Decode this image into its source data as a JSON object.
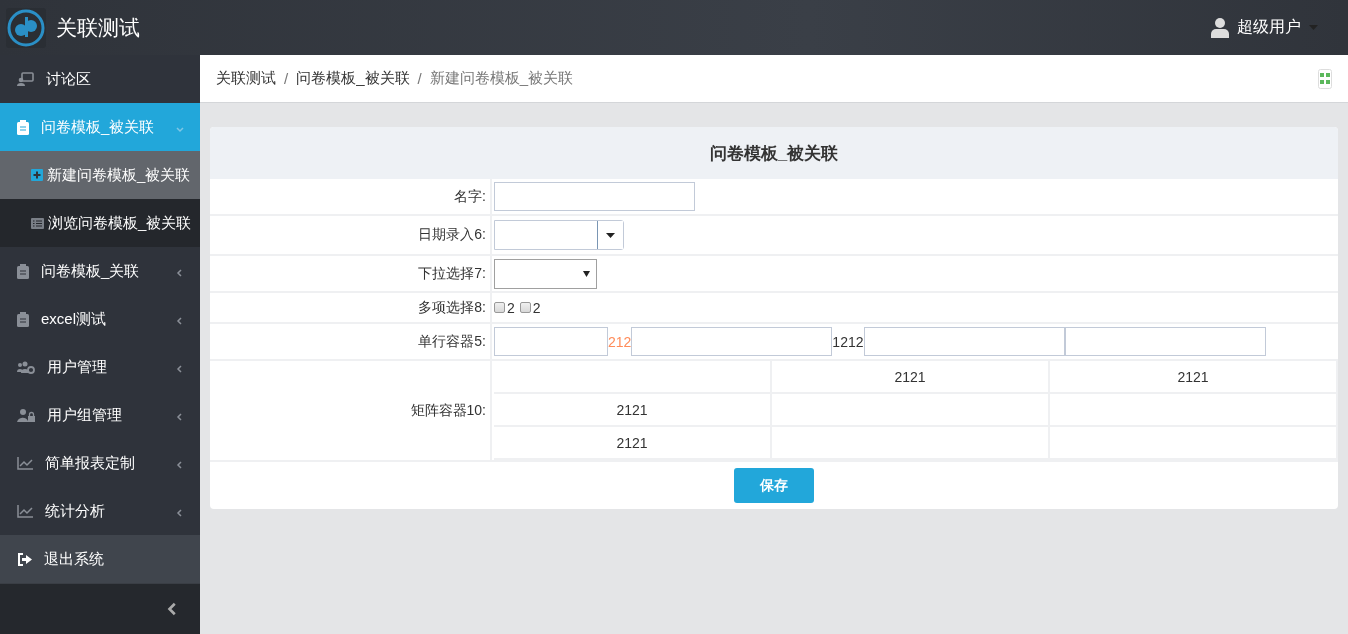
{
  "header": {
    "title": "关联测试",
    "user": "超级用户"
  },
  "sidebar": {
    "items": [
      {
        "label": "讨论区",
        "kind": "link",
        "selected": false
      },
      {
        "label": "问卷模板_被关联",
        "kind": "menu",
        "selected": true,
        "expanded": true,
        "children": [
          {
            "label": "新建问卷模板_被关联",
            "selected": true
          },
          {
            "label": "浏览问卷模板_被关联",
            "selected": false
          }
        ]
      },
      {
        "label": "问卷模板_关联",
        "kind": "menu",
        "selected": false,
        "expanded": false
      },
      {
        "label": "excel测试",
        "kind": "menu",
        "selected": false,
        "expanded": false
      },
      {
        "label": "用户管理",
        "kind": "menu",
        "selected": false,
        "expanded": false
      },
      {
        "label": "用户组管理",
        "kind": "menu",
        "selected": false,
        "expanded": false
      },
      {
        "label": "简单报表定制",
        "kind": "menu",
        "selected": false,
        "expanded": false
      },
      {
        "label": "统计分析",
        "kind": "menu",
        "selected": false,
        "expanded": false
      },
      {
        "label": "退出系统",
        "kind": "logout",
        "selected": false
      }
    ]
  },
  "breadcrumb": {
    "separator": "/",
    "items": [
      {
        "label": "关联测试",
        "current": false
      },
      {
        "label": "问卷模板_被关联",
        "current": false
      },
      {
        "label": "新建问卷模板_被关联",
        "current": true
      }
    ]
  },
  "form": {
    "title": "问卷模板_被关联",
    "fields": [
      {
        "kind": "text",
        "label": "名字:"
      },
      {
        "kind": "date",
        "label": "日期录入6:"
      },
      {
        "kind": "select",
        "label": "下拉选择7:"
      },
      {
        "kind": "checkboxes",
        "label": "多项选择8:",
        "options": [
          {
            "label": "2",
            "checked": false
          },
          {
            "label": "2",
            "checked": false
          }
        ]
      },
      {
        "kind": "group",
        "label": "单行容器5:",
        "items": [
          {
            "kind": "input"
          },
          {
            "kind": "text",
            "text": "212",
            "color": "#ff8c5a"
          },
          {
            "kind": "input",
            "wide": true
          },
          {
            "kind": "text",
            "text": "1212",
            "color": "#333333"
          },
          {
            "kind": "input",
            "wide": true
          },
          {
            "kind": "input",
            "wide": true
          }
        ]
      },
      {
        "kind": "matrix",
        "label": "矩阵容器10:",
        "rows": [
          [
            null,
            "2121",
            "2121"
          ],
          [
            "2121",
            null,
            null
          ],
          [
            "2121",
            null,
            null
          ]
        ]
      }
    ],
    "save": "保存"
  }
}
